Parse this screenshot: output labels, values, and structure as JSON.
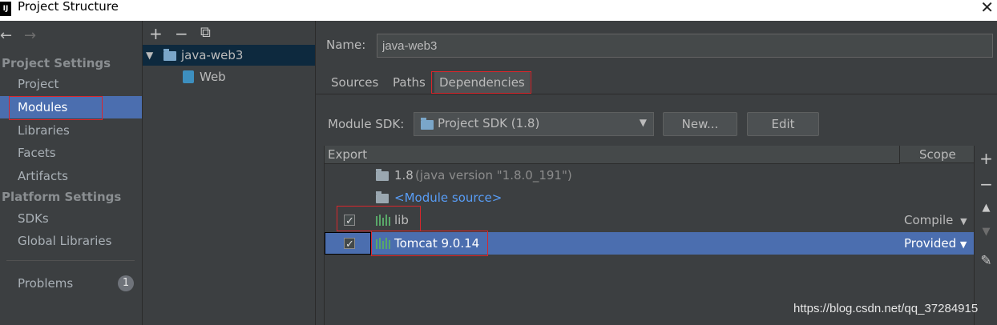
{
  "window": {
    "title": "Project Structure",
    "app_icon_label": "IJ"
  },
  "nav": {
    "back_glyph": "←",
    "forward_glyph": "→",
    "project_settings_header": "Project Settings",
    "items_project": [
      "Project",
      "Modules",
      "Libraries",
      "Facets",
      "Artifacts"
    ],
    "platform_settings_header": "Platform Settings",
    "items_platform": [
      "SDKs",
      "Global Libraries"
    ],
    "problems_label": "Problems",
    "problems_count": "1",
    "selected": "Modules"
  },
  "tree": {
    "tools": {
      "add": "+",
      "remove": "−",
      "copy": "⧉"
    },
    "module_name": "java-web3",
    "facet_name": "Web"
  },
  "module": {
    "name_label": "Name:",
    "name_value": "java-web3",
    "tabs": [
      "Sources",
      "Paths",
      "Dependencies"
    ],
    "active_tab": "Dependencies",
    "sdk_label": "Module SDK:",
    "sdk_value": "Project SDK (1.8)",
    "new_button": "New...",
    "edit_button": "Edit"
  },
  "dependencies": {
    "col_export": "Export",
    "col_scope": "Scope",
    "rows": [
      {
        "name": "1.8",
        "detail": "(java version \"1.8.0_191\")",
        "scope": "",
        "checked": false
      },
      {
        "name": "<Module source>",
        "detail": "",
        "scope": "",
        "checked": false
      },
      {
        "name": "lib",
        "detail": "",
        "scope": "Compile",
        "checked": true
      },
      {
        "name": "Tomcat 9.0.14",
        "detail": "",
        "scope": "Provided",
        "checked": true
      }
    ],
    "side_tools": [
      "+",
      "−",
      "▲",
      "▼",
      "✎"
    ]
  },
  "watermark": "https://blog.csdn.net/qq_37284915",
  "colors": {
    "selection": "#4b6eaf",
    "highlight_box": "#d9262c",
    "module_source_link": "#589df6",
    "library_green": "#59a869"
  }
}
